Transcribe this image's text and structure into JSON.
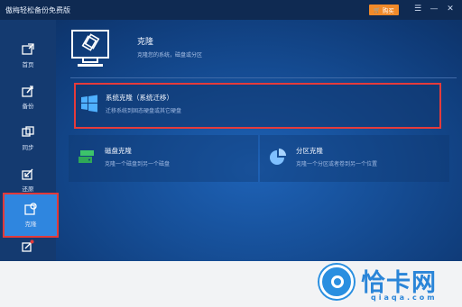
{
  "window": {
    "title": "傲梅轻松备份免费版",
    "buy_label": "购买",
    "controls": [
      "☰",
      "—",
      "✕"
    ]
  },
  "sidebar": {
    "items": [
      {
        "label": "首页",
        "icon": "home-icon"
      },
      {
        "label": "备份",
        "icon": "backup-icon"
      },
      {
        "label": "同步",
        "icon": "sync-icon"
      },
      {
        "label": "还原",
        "icon": "restore-icon"
      },
      {
        "label": "克隆",
        "icon": "clone-icon",
        "active": true
      },
      {
        "label": "",
        "icon": "tools-icon"
      }
    ]
  },
  "header": {
    "title": "克隆",
    "subtitle": "克隆您的系统，磁盘或分区"
  },
  "cards": {
    "system_clone": {
      "title": "系统克隆（系统迁移）",
      "desc": "迁移系统到固态硬盘或其它硬盘"
    },
    "disk_clone": {
      "title": "磁盘克隆",
      "desc": "克隆一个磁盘到另一个磁盘"
    },
    "partition_clone": {
      "title": "分区克隆",
      "desc": "克隆一个分区或者卷到另一个位置"
    }
  },
  "watermark": {
    "text": "恰卡网",
    "url": "qiaqa.com"
  },
  "colors": {
    "accent": "#2f86df",
    "highlight": "#e53b3b",
    "buy": "#f08a2a"
  }
}
